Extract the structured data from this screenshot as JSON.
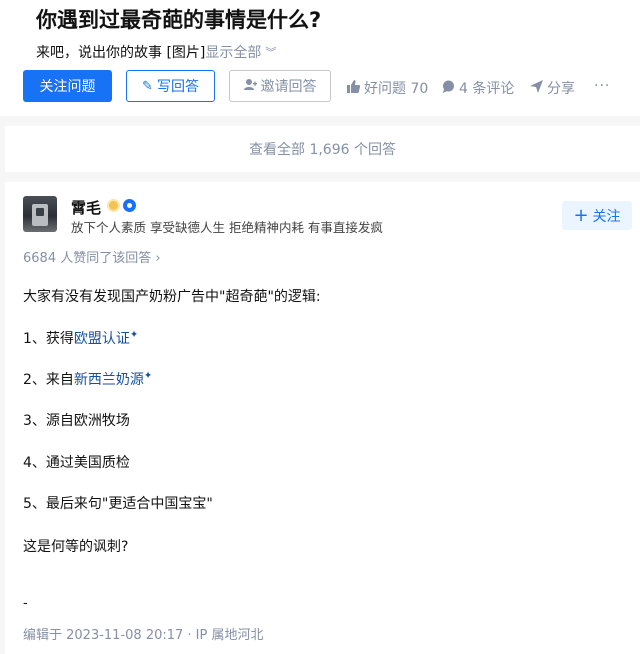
{
  "question": {
    "title": "你遇到过最奇葩的事情是什么?",
    "detail": "来吧，说出你的故事 [图片]",
    "expand_label": "显示全部"
  },
  "actions": {
    "follow_question": "关注问题",
    "write_answer": "写回答",
    "invite_answer": "邀请回答",
    "good_question": "好问题 70",
    "comments": "4 条评论",
    "share": "分享",
    "more": "···"
  },
  "view_all": "查看全部 1,696 个回答",
  "answer": {
    "author_name": "霄毛",
    "author_bio": "放下个人素质 享受缺德人生 拒绝精神内耗 有事直接发疯",
    "follow_label": "关注",
    "vote_info": "6684 人赞同了该回答 ›",
    "intro": "大家有没有发现国产奶粉广告中\"超奇葩\"的逻辑:",
    "item1_prefix": "1、获得",
    "item1_link": "欧盟认证",
    "item2_prefix": "2、来自",
    "item2_link": "新西兰奶源",
    "item3": "3、源自欧洲牧场",
    "item4": "4、通过美国质检",
    "item5": "5、最后来句\"更适合中国宝宝\"",
    "conclusion": "这是何等的讽刺?",
    "dash": "-",
    "edit_info": "编辑于 2023-11-08 20:17 · IP 属地河北"
  },
  "icons": {
    "pencil": "pencil-icon",
    "invite": "person-plus-icon",
    "thumb": "thumb-up-icon",
    "comment": "comment-bubble-icon",
    "share": "paper-plane-icon"
  },
  "colors": {
    "brand_blue": "#1772f6",
    "link_blue": "#175199",
    "meta_gray": "#8590a6"
  }
}
